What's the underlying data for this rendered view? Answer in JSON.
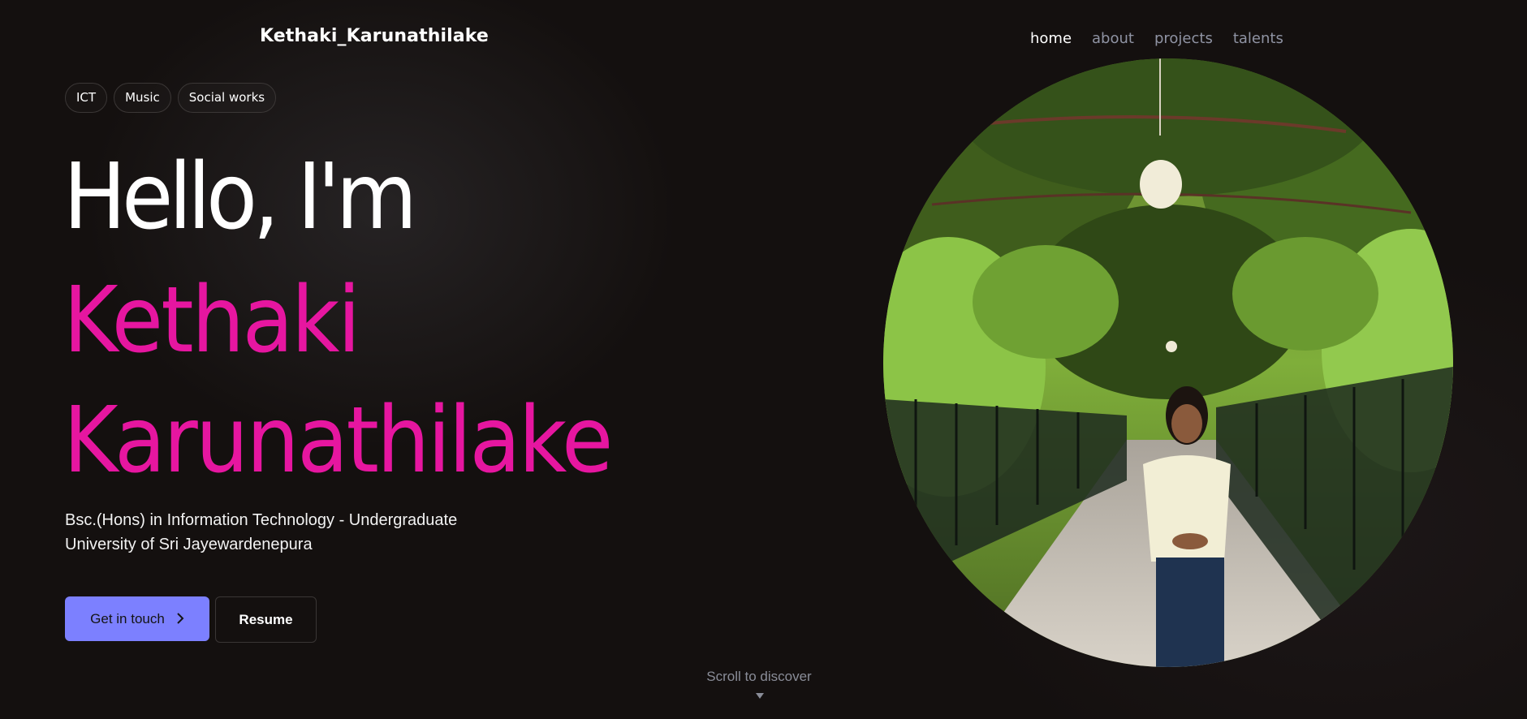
{
  "header": {
    "brand": "Kethaki_Karunathilake",
    "nav": [
      "home",
      "about",
      "projects",
      "talents"
    ]
  },
  "tags": [
    "ICT",
    "Music",
    "Social works"
  ],
  "hero": {
    "greeting": "Hello, I'm",
    "first_name": "Kethaki",
    "last_name": "Karunathilake",
    "subtitle_line1": "Bsc.(Hons) in Information Technology - Undergraduate",
    "subtitle_line2": "University of Sri Jayewardenepura"
  },
  "actions": {
    "contact_label": "Get in touch",
    "resume_label": "Resume"
  },
  "scroll_hint": "Scroll to discover",
  "colors": {
    "background": "#14100f",
    "accent_pink": "#e616a0",
    "button_primary": "#7c80ff",
    "nav_inactive": "#8f93a3"
  },
  "icons": {
    "contact_button": "chevron-right-icon",
    "scroll": "caret-down-icon"
  }
}
